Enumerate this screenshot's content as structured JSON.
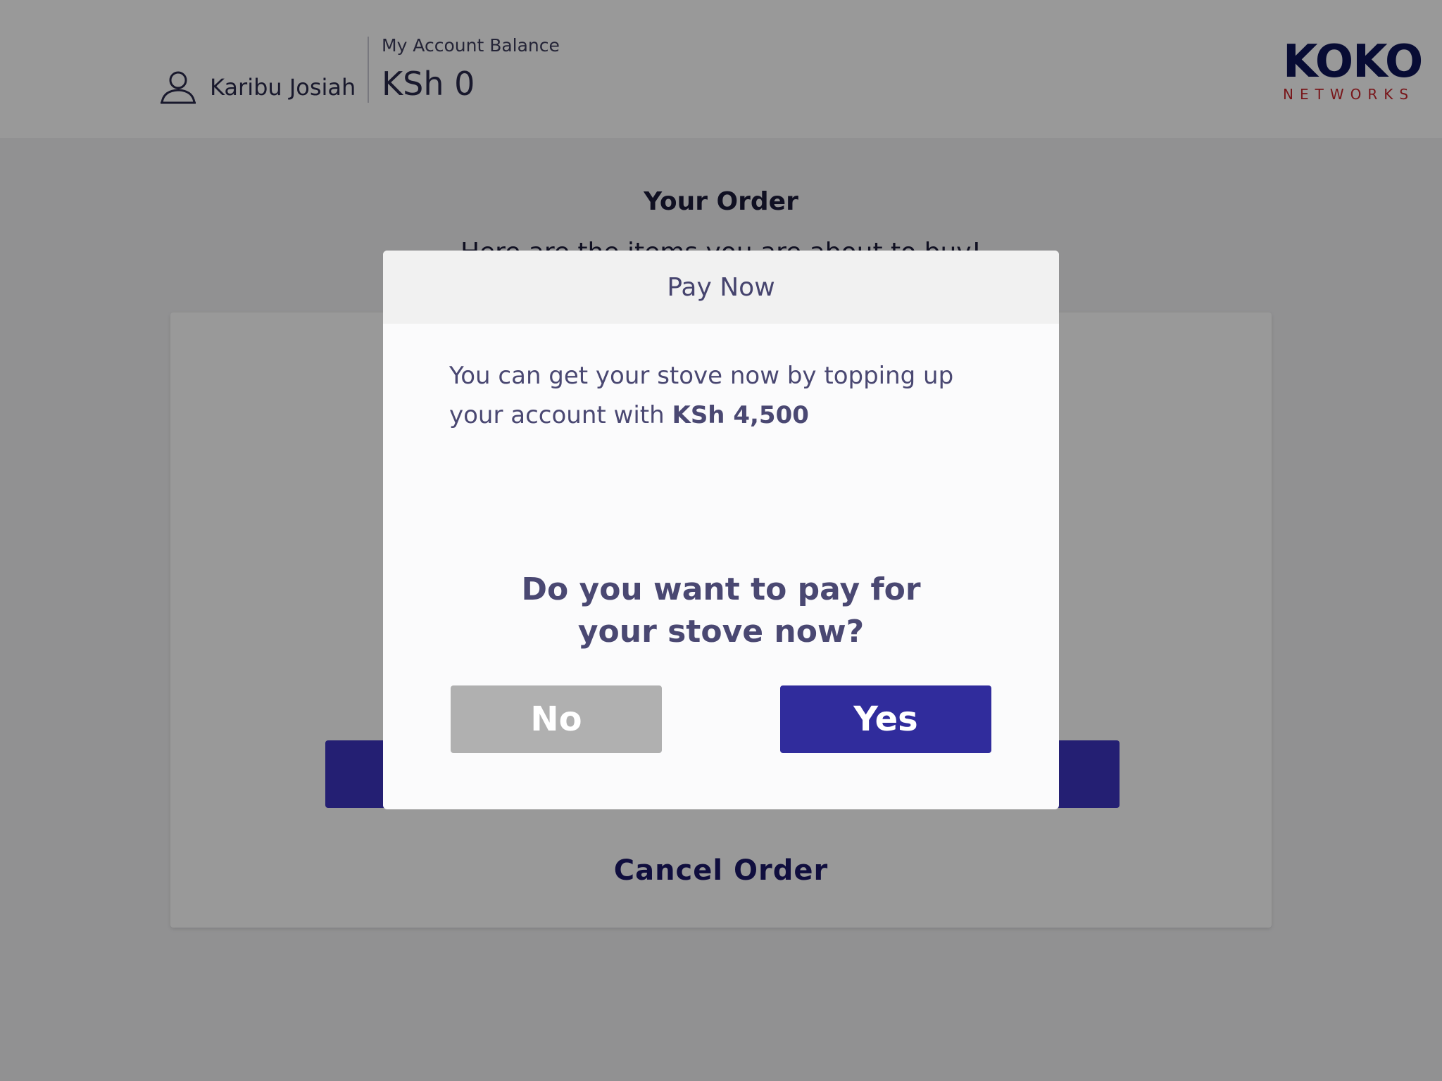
{
  "header": {
    "user_name": "Karibu Josiah",
    "balance_label": "My Account Balance",
    "balance_value": "KSh 0",
    "logo_main": "KOKO",
    "logo_sub": "NETWORKS",
    "user_icon": "user-icon"
  },
  "page": {
    "title": "Your Order",
    "subtitle": "Here are the items you are about to buy!",
    "cancel_label": "Cancel Order"
  },
  "modal": {
    "title": "Pay Now",
    "message_prefix": "You can get your stove now by topping up your account with ",
    "message_amount": "KSh 4,500",
    "question_line1": "Do you want to pay for",
    "question_line2": "your stove now?",
    "no_label": "No",
    "yes_label": "Yes"
  },
  "colors": {
    "brand_navy": "#0e1557",
    "brand_red": "#c9262c",
    "primary_button": "#302c9c",
    "secondary_button": "#b0b0b0",
    "overlay": "rgba(0,0,0,0.40)"
  }
}
